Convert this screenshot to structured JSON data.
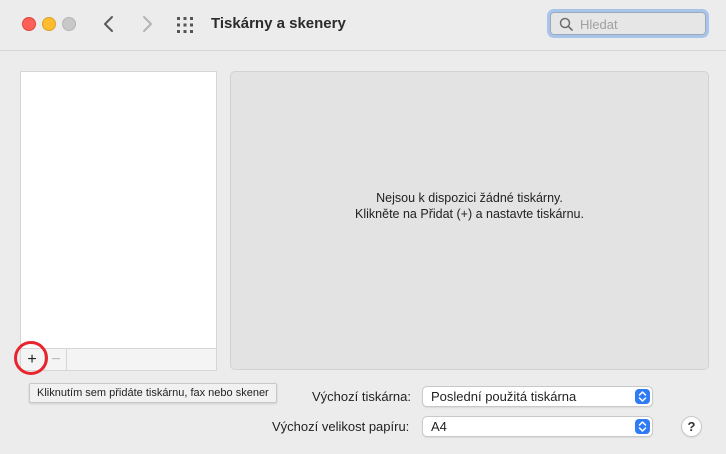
{
  "window": {
    "title": "Tiskárny a skenery",
    "search_placeholder": "Hledat"
  },
  "icons": {
    "back": "chevron-left-icon",
    "forward": "chevron-right-icon",
    "grid": "grid-icon",
    "search": "search-icon",
    "add": "plus-icon",
    "remove": "minus-icon",
    "popup": "chevron-up-down-icon",
    "help": "question-icon"
  },
  "printer_list": {
    "items": [],
    "add_label": "+",
    "remove_label": "−"
  },
  "tooltip": {
    "text": "Kliknutím sem přidáte tiskárnu, fax nebo skener"
  },
  "detail": {
    "empty_line1": "Nejsou k dispozici žádné tiskárny.",
    "empty_line2": "Klikněte na Přidat (+) a nastavte tiskárnu."
  },
  "defaults": {
    "printer_label": "Výchozí tiskárna:",
    "printer_value": "Poslední použitá tiskárna",
    "paper_label": "Výchozí velikost papíru:",
    "paper_value": "A4"
  },
  "help_label": "?",
  "colors": {
    "accent": "#2f7bf5",
    "highlight": "#e8242e",
    "close": "#fe5f57",
    "minimize": "#febc2e"
  }
}
